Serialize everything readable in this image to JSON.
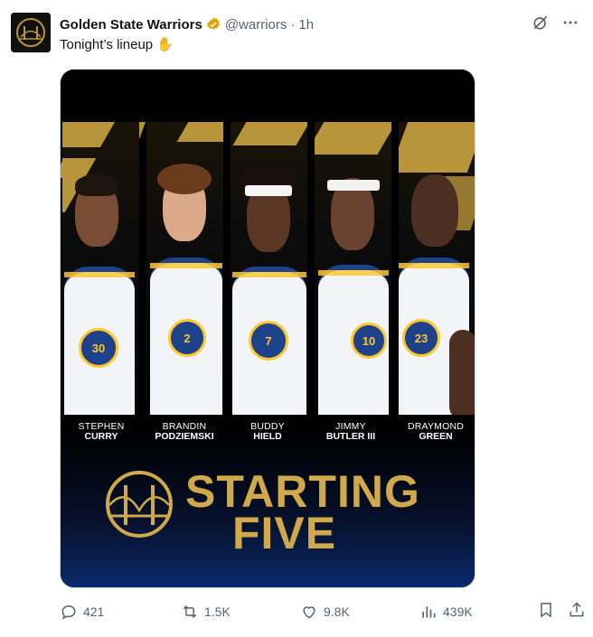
{
  "account": {
    "display_name": "Golden State Warriors",
    "handle": "@warriors",
    "separator": "·",
    "time": "1h",
    "verified": true,
    "verified_color": "#e0a100"
  },
  "tweet": {
    "text": "Tonight’s lineup ✋"
  },
  "media": {
    "players": [
      {
        "first": "STEPHEN",
        "last": "CURRY",
        "number": "30"
      },
      {
        "first": "BRANDIN",
        "last": "PODZIEMSKI",
        "number": "2"
      },
      {
        "first": "BUDDY",
        "last": "HIELD",
        "number": "7"
      },
      {
        "first": "JIMMY",
        "last": "BUTLER III",
        "number": "10"
      },
      {
        "first": "DRAYMOND",
        "last": "GREEN",
        "number": "23"
      }
    ],
    "banner_line1": "STARTING",
    "banner_line2": "FIVE",
    "gold": "#cfa94a",
    "warriors_blue": "#1d428a",
    "warriors_yellow": "#ffc72c"
  },
  "actions": {
    "replies": "421",
    "reposts": "1.5K",
    "likes": "9.8K",
    "views": "439K"
  },
  "icons": [
    "reply-icon",
    "repost-icon",
    "like-icon",
    "views-icon",
    "bookmark-icon",
    "share-icon",
    "grok-icon",
    "more-icon",
    "verified-icon"
  ]
}
